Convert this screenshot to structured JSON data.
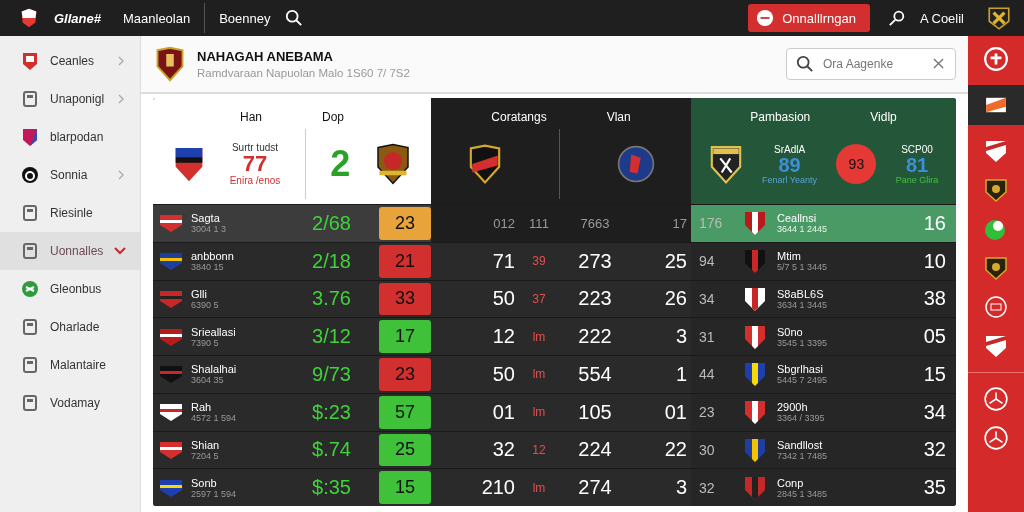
{
  "top_bar": {
    "brand": "Gllane#",
    "nav": [
      "Maanleolan",
      "Boenney"
    ],
    "action_button": "Onnalllrngan",
    "user": "A Coelil"
  },
  "sidebar": {
    "items": [
      {
        "label": "Ceanles",
        "selected": false,
        "expanded": false
      },
      {
        "label": "Unaponigl",
        "selected": false,
        "expanded": false
      },
      {
        "label": "blarpodan",
        "selected": false
      },
      {
        "label": "Sonnia",
        "selected": false,
        "expanded": false
      },
      {
        "label": "Riesinle",
        "selected": false
      },
      {
        "label": "Uonnalles",
        "selected": true,
        "expanded": true
      },
      {
        "label": "Gleonbus",
        "selected": false
      },
      {
        "label": "Oharlade",
        "selected": false
      },
      {
        "label": "Malantaire",
        "selected": false
      },
      {
        "label": "Vodamay",
        "selected": false
      }
    ]
  },
  "header": {
    "title": "NAHAGAH ANEBAMA",
    "subtitle": "Ramdvaraan Napuolan Malo 1S60 7/ 7S2",
    "search": {
      "placeholder": "Ora Aagenke"
    }
  },
  "match": {
    "left": {
      "columns": [
        "Han",
        "Dop"
      ],
      "label": "Surtr tudst",
      "score": "77",
      "note": "Enira /enos",
      "result": "2"
    },
    "middle": {
      "columns": [
        "Coratangs",
        "Vlan"
      ]
    },
    "right": {
      "columns": [
        "Pambasion",
        "Vidlp"
      ],
      "home": {
        "label": "SrAdlA",
        "score": "89",
        "note": "Fenarl Yeanty"
      },
      "center": "93",
      "away": {
        "label": "SCP00",
        "score": "81",
        "note": "Pane Glira"
      }
    }
  },
  "rows": [
    {
      "selected": true,
      "name": "Sagta",
      "sub": "3004 1 3",
      "odds": "2/68",
      "badge": "23",
      "color": "#e8a33a",
      "c1": "012",
      "c2": "111",
      "c3": "7663",
      "c4": "17",
      "rank": "176",
      "team": "Ceallnsi",
      "team_sub": "3644 1 2445",
      "score": "16"
    },
    {
      "selected": false,
      "name": "anbbonn",
      "sub": "3840 15",
      "odds": "2/18",
      "badge": "21",
      "color": "#d22f2f",
      "c1": "71",
      "c2": "39",
      "c3": "273",
      "c4": "25",
      "rank": "94",
      "team": "Mtim",
      "team_sub": "5/7 5 1 3445",
      "score": "10"
    },
    {
      "selected": false,
      "name": "Glli",
      "sub": "6390 5",
      "odds": "3.76",
      "badge": "33",
      "color": "#d22f2f",
      "c1": "50",
      "c2": "37",
      "c3": "223",
      "c4": "26",
      "rank": "34",
      "team": "S8aBL6S",
      "team_sub": "3634 1 3445",
      "score": "38"
    },
    {
      "selected": false,
      "name": "Srieallasi",
      "sub": "7390 5",
      "odds": "3/12",
      "badge": "17",
      "color": "#3fc23a",
      "c1": "12",
      "c2": "lm",
      "c3": "222",
      "c4": "3",
      "rank": "31",
      "team": "S0no",
      "team_sub": "3545 1 3395",
      "score": "05"
    },
    {
      "selected": false,
      "name": "Shalalhai",
      "sub": "3604 35",
      "odds": "9/73",
      "badge": "23",
      "color": "#d22f2f",
      "c1": "50",
      "c2": "lm",
      "c3": "554",
      "c4": "1",
      "rank": "44",
      "team": "Sbgrlhasi",
      "team_sub": "5445 7 2495",
      "score": "15"
    },
    {
      "selected": false,
      "name": "Rah",
      "sub": "4572 1 594",
      "odds": "$:23",
      "badge": "57",
      "color": "#3fc23a",
      "c1": "01",
      "c2": "lm",
      "c3": "105",
      "c4": "01",
      "rank": "23",
      "team": "2900h",
      "team_sub": "3364 / 3395",
      "score": "34"
    },
    {
      "selected": false,
      "name": "Shian",
      "sub": "7204 5",
      "odds": "$.74",
      "badge": "25",
      "color": "#3fc23a",
      "c1": "32",
      "c2": "12",
      "c3": "224",
      "c4": "22",
      "rank": "30",
      "team": "Sandllost",
      "team_sub": "7342 1 7485",
      "score": "32"
    },
    {
      "selected": false,
      "name": "Sonb",
      "sub": "2597 1 594",
      "odds": "$:35",
      "badge": "15",
      "color": "#3fc23a",
      "c1": "210",
      "c2": "lm",
      "c3": "274",
      "c4": "3",
      "rank": "32",
      "team": "Conp",
      "team_sub": "2845 1 3485",
      "score": "35"
    }
  ]
}
